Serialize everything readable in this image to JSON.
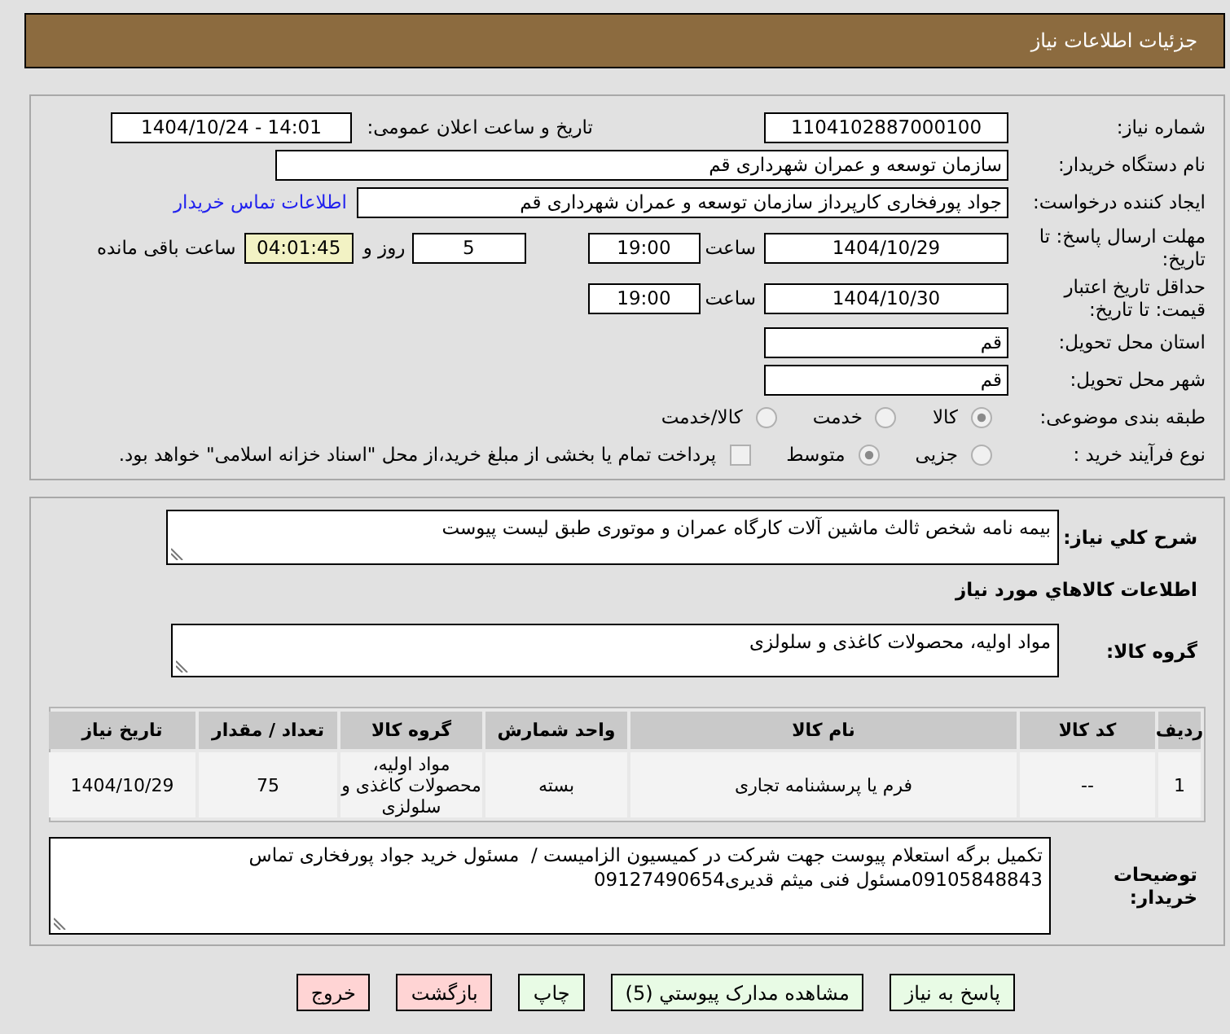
{
  "header": {
    "title": "جزئیات اطلاعات نیاز"
  },
  "details": {
    "need_number": {
      "label": "شماره نیاز:",
      "value": "1104102887000100"
    },
    "announce_datetime": {
      "label": "تاریخ و ساعت اعلان عمومی:",
      "value": "1404/10/24 - 14:01"
    },
    "buyer_org": {
      "label": "نام دستگاه خریدار:",
      "value": "سازمان توسعه و عمران شهرداری قم"
    },
    "requester": {
      "label": "ایجاد کننده درخواست:",
      "value": "جواد پورفخاری کارپرداز سازمان توسعه و عمران شهرداری قم",
      "contact_link": "اطلاعات تماس خریدار"
    },
    "response_deadline": {
      "label": "مهلت ارسال پاسخ: تا تاریخ:",
      "date": "1404/10/29",
      "time_label": "ساعت",
      "time": "19:00",
      "days": "5",
      "days_label": "روز و",
      "remaining": "04:01:45",
      "remaining_label": "ساعت باقی مانده"
    },
    "price_validity": {
      "label": "حداقل تاریخ اعتبار قیمت: تا تاریخ:",
      "date": "1404/10/30",
      "time_label": "ساعت",
      "time": "19:00"
    },
    "province": {
      "label": "استان محل تحویل:",
      "value": "قم"
    },
    "city": {
      "label": "شهر محل تحویل:",
      "value": "قم"
    },
    "category": {
      "label": "طبقه بندی موضوعی:",
      "options": [
        {
          "label": "کالا",
          "selected": true
        },
        {
          "label": "خدمت",
          "selected": false
        },
        {
          "label": "کالا/خدمت",
          "selected": false
        }
      ]
    },
    "purchase_process": {
      "label": "نوع فرآیند خرید :",
      "options": [
        {
          "label": "جزیی",
          "selected": false
        },
        {
          "label": "متوسط",
          "selected": true
        }
      ],
      "treasury_payment": {
        "label": "پرداخت تمام یا بخشی از مبلغ خرید،از محل \"اسناد خزانه اسلامی\" خواهد بود.",
        "checked": false
      }
    }
  },
  "need": {
    "description": {
      "label": "شرح کلي نیاز:",
      "value": "بیمه نامه شخص ثالث ماشین آلات کارگاه عمران و موتوری طبق لیست پیوست"
    },
    "goods_heading": "اطلاعات کالاهاي مورد نیاز",
    "goods_group": {
      "label": "گروه کالا:",
      "value": "مواد اولیه، محصولات کاغذی و سلولزی"
    },
    "table": {
      "columns": [
        "ردیف",
        "کد کالا",
        "نام کالا",
        "واحد شمارش",
        "گروه کالا",
        "تعداد / مقدار",
        "تاریخ نیاز"
      ],
      "rows": [
        [
          "1",
          "--",
          "فرم یا پرسشنامه تجاری",
          "بسته",
          "مواد اولیه، محصولات کاغذی و سلولزی",
          "75",
          "1404/10/29"
        ]
      ]
    },
    "buyer_notes": {
      "label": "توضیحات خریدار:",
      "value": "تکمیل برگه استعلام پیوست جهت شرکت در کمیسیون الزامیست /  مسئول خرید جواد پورفخاری تماس\n09105848843مسئول فنی میثم قدیری09127490654"
    }
  },
  "buttons": [
    {
      "label": "پاسخ به نیاز",
      "kind": "action"
    },
    {
      "label": "مشاهده مدارک پیوستي (5)",
      "kind": "action"
    },
    {
      "label": "چاپ",
      "kind": "action"
    },
    {
      "label": "بازگشت",
      "kind": "danger"
    },
    {
      "label": "خروج",
      "kind": "danger"
    }
  ]
}
